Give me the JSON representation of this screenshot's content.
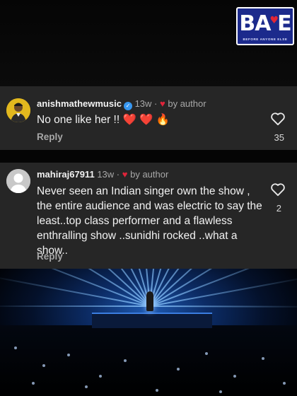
{
  "logo": {
    "text_left": "BA",
    "text_right": "E",
    "tagline": "BEFORE ANYONE ELSE",
    "color": "#1c2a8c"
  },
  "comments": [
    {
      "username": "anishmathewmusic",
      "verified": true,
      "time": "13w",
      "separator": "·",
      "author_label": "by author",
      "text": "No one like her !! ❤️ ❤️ 🔥",
      "reply_label": "Reply",
      "likes": "35",
      "avatar_icon": "profile-photo"
    },
    {
      "username": "mahiraj67911",
      "verified": false,
      "time": "13w",
      "separator": "·",
      "author_label": "by author",
      "text": "Never seen an Indian singer own the show , the entire audience and  was electric to say the least..top class performer and a flawless enthralling show ..sunidhi rocked ..what a show..",
      "reply_label": "Reply",
      "likes": "2",
      "avatar_icon": "default-avatar"
    }
  ],
  "colors": {
    "card_bg": "#262626",
    "heart_red": "#e0243a",
    "verified_blue": "#3797f0",
    "muted_text": "#a8a8a8"
  }
}
